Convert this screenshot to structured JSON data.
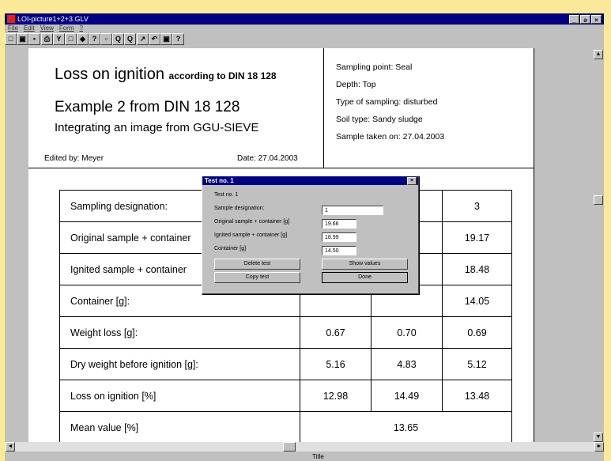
{
  "window": {
    "title": "LOI-picture1+2+3.GLV",
    "controls": [
      "_",
      "ə",
      "×"
    ]
  },
  "menu": [
    "File",
    "Edit",
    "View",
    "Form",
    "?"
  ],
  "toolbar": [
    "□",
    "▣",
    "▪",
    "⎙",
    "Y",
    "□",
    "◆",
    "?",
    "▫",
    "Q",
    "Q",
    "↗",
    "↶",
    "▣",
    "?"
  ],
  "header": {
    "title_main": "Loss on ignition",
    "title_suffix": "according to DIN 18 128",
    "line2": "Example 2 from DIN 18 128",
    "line3": "Integrating an image from GGU-SIEVE",
    "edited_by": "Edited by:  Meyer",
    "date": "Date:  27.04.2003"
  },
  "info": [
    "Sampling point:  Seal",
    "Depth:  Top",
    "Type of sampling:  disturbed",
    "Soil type:  Sandy sludge",
    "Sample taken on:  27.04.2003"
  ],
  "table": {
    "rows": [
      {
        "label": "Sampling designation:",
        "v1": "",
        "v2": "",
        "v3": "3"
      },
      {
        "label": "Original sample + container",
        "v1": "",
        "v2": "",
        "v3": "19.17"
      },
      {
        "label": "Ignited sample + container",
        "v1": "",
        "v2": "",
        "v3": "18.48"
      },
      {
        "label": "Container [g]:",
        "v1": "",
        "v2": "",
        "v3": "14.05"
      },
      {
        "label": "Weight loss [g]:",
        "v1": "0.67",
        "v2": "0.70",
        "v3": "0.69"
      },
      {
        "label": "Dry weight before ignition [g]:",
        "v1": "5.16",
        "v2": "4.83",
        "v3": "5.12"
      },
      {
        "label": "Loss on ignition [%]",
        "v1": "12.98",
        "v2": "14.49",
        "v3": "13.48"
      }
    ],
    "mean_label": "Mean value [%]",
    "mean_value": "13.65"
  },
  "dialog": {
    "title": "Test no. 1",
    "close": "×",
    "test_label": "Test no. 1",
    "fields": [
      {
        "label": "Sample designation:",
        "value": "1"
      },
      {
        "label": "Original sample + container [g]",
        "value": "19.66"
      },
      {
        "label": "Ignited sample + container [g]",
        "value": "18.99"
      },
      {
        "label": "Container [g]",
        "value": "14.50"
      }
    ],
    "buttons": {
      "delete": "Delete test",
      "show": "Show values",
      "copy": "Copy test",
      "done": "Done"
    }
  },
  "scroll": {
    "up": "▲",
    "down": "▼",
    "left": "◄",
    "right": "►"
  },
  "status": {
    "text": "Title"
  }
}
